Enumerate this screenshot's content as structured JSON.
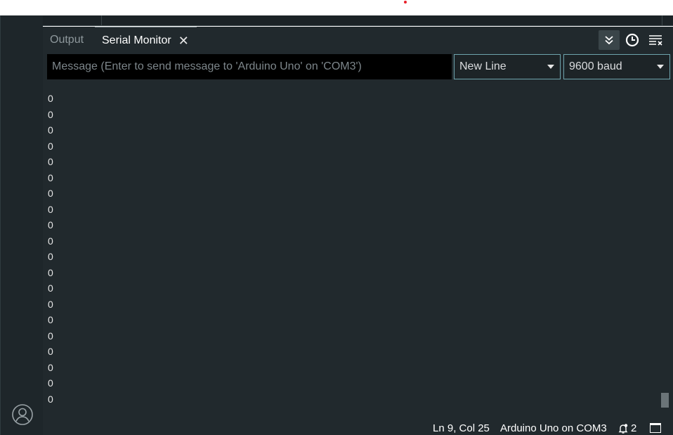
{
  "tabs": [
    {
      "label": "Output",
      "active": false
    },
    {
      "label": "Serial Monitor",
      "active": true
    }
  ],
  "toolbar": {
    "autoscroll_icon": "double-chevron-down-icon",
    "timestamp_icon": "clock-icon",
    "clear_icon": "clear-output-icon"
  },
  "message": {
    "placeholder": "Message (Enter to send message to 'Arduino Uno' on 'COM3')",
    "value": ""
  },
  "line_ending": {
    "selected": "New Line"
  },
  "baud_rate": {
    "selected": "9600 baud"
  },
  "output_lines": [
    "0",
    "0",
    "0",
    "0",
    "0",
    "0",
    "0",
    "0",
    "0",
    "0",
    "0",
    "0",
    "0",
    "0",
    "0",
    "0",
    "0",
    "0",
    "0",
    "0"
  ],
  "status_bar": {
    "position": "Ln 9, Col 25",
    "board": "Arduino Uno on COM3",
    "notifications": "2"
  },
  "colors": {
    "panel_bg": "#21292d",
    "input_bg": "#000000",
    "select_border": "#6ea4ad",
    "accent_dot": "#e8202a"
  }
}
